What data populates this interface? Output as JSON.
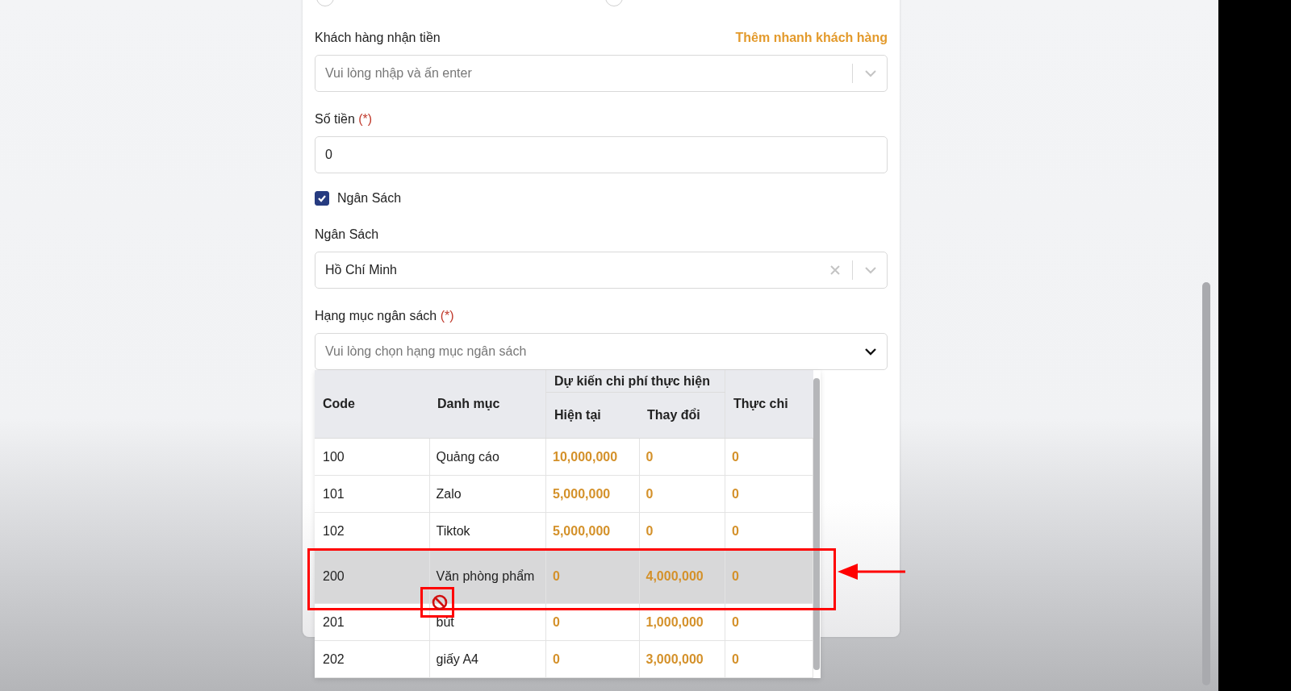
{
  "radios": [
    {
      "selected": false
    },
    {
      "selected": false
    }
  ],
  "customer_field": {
    "label": "Khách hàng nhận tiền",
    "link": "Thêm nhanh khách hàng",
    "placeholder": "Vui lòng nhập và ấn enter"
  },
  "amount_field": {
    "label": "Số tiền",
    "required_mark": "(*)",
    "value": "0"
  },
  "budget_checkbox": {
    "label": "Ngân Sách",
    "checked": true
  },
  "budget_select": {
    "label": "Ngân Sách",
    "value": "Hồ Chí Minh"
  },
  "category_select": {
    "label": "Hạng mục ngân sách",
    "required_mark": "(*)",
    "placeholder": "Vui lòng chọn hạng mục ngân sách",
    "expanded": true
  },
  "table": {
    "columns": [
      "Code",
      "Danh mục",
      "Hiện tại",
      "Thay đổi",
      "Thực chi"
    ],
    "group_header": "Dự kiến chi phí thực hiện",
    "rows": [
      {
        "code": "100",
        "name": "Quảng cáo",
        "current": "10,000,000",
        "change": "0",
        "actual": "0",
        "hovered": false
      },
      {
        "code": "101",
        "name": "Zalo",
        "current": "5,000,000",
        "change": "0",
        "actual": "0",
        "hovered": false
      },
      {
        "code": "102",
        "name": "Tiktok",
        "current": "5,000,000",
        "change": "0",
        "actual": "0",
        "hovered": false
      },
      {
        "code": "200",
        "name": "Văn phòng phẩm",
        "current": "0",
        "change": "4,000,000",
        "actual": "0",
        "hovered": true
      },
      {
        "code": "201",
        "name": "bút",
        "current": "0",
        "change": "1,000,000",
        "actual": "0",
        "hovered": false
      },
      {
        "code": "202",
        "name": "giấy A4",
        "current": "0",
        "change": "3,000,000",
        "actual": "0",
        "hovered": false
      }
    ]
  }
}
